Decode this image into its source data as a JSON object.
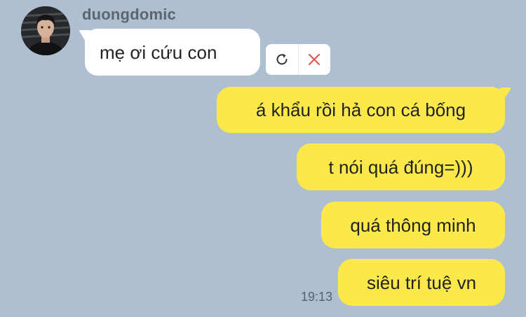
{
  "chat": {
    "sender_name": "duongdomic",
    "incoming_message": "mẹ ơi cứu con",
    "outgoing_messages": [
      "á khẩu rồi hả con cá bống",
      "t nói quá đúng=)))",
      "quá thông minh",
      "siêu trí tuệ vn"
    ],
    "last_timestamp": "19:13"
  },
  "failed_message_actions": {
    "retry_icon": "refresh-icon",
    "delete_icon": "close-icon",
    "retry_color": "#333333",
    "delete_color": "#e5584f"
  },
  "colors": {
    "background": "#adbfd1",
    "incoming_bubble": "#ffffff",
    "outgoing_bubble": "#fbe84a"
  }
}
